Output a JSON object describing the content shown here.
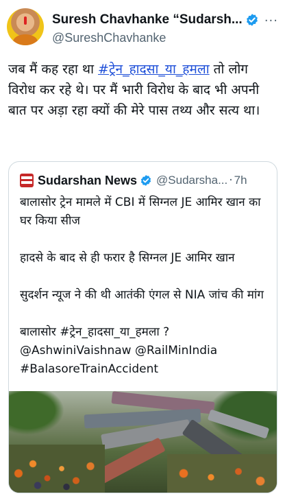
{
  "tweet": {
    "display_name": "Suresh Chavhanke “Sudarsh...",
    "handle": "@SureshChavhanke",
    "more_label": "···",
    "text_line1": "जब मैं कह रहा था ",
    "hashtag": "#ट्रेन_हादसा_या_हमला",
    "text_line1_tail": " तो लोग",
    "text_rest": "विरोध कर रहे थे। पर मैं भारी विरोध के बाद भी अपनी बात पर अड़ा रहा क्यों की मेरे पास तथ्य और सत्य था।"
  },
  "quote": {
    "name": "Sudarshan News",
    "handle": "@Sudarsha...",
    "dot": "·",
    "time": "7h",
    "para1": "बालासोर ट्रेन मामले में CBI में सिग्नल JE आमिर खान का घर किया सीज",
    "para2": "हादसे के बाद से ही फरार है सिग्नल JE आमिर खान",
    "para3": "सुदर्शन न्यूज ने की थी आतंकी एंगल से NIA जांच की मांग",
    "para4_l1": "बालासोर #ट्रेन_हादसा_या_हमला ?",
    "para4_l2": "@AshwiniVaishnaw @RailMinIndia",
    "para4_l3": "#BalasoreTrainAccident"
  },
  "icons": {
    "verified": "verified-badge-icon",
    "more": "more-options-icon",
    "logo": "sudarshan-news-logo-icon"
  },
  "colors": {
    "verified_blue": "#1d9bf0",
    "link_blue": "#1d4ed8",
    "muted": "#536471"
  }
}
